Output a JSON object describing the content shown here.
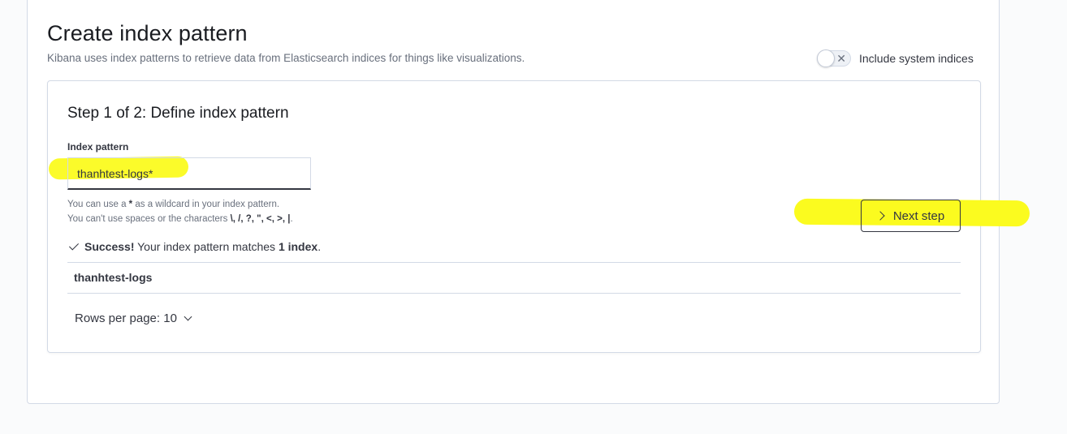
{
  "page": {
    "title": "Create index pattern",
    "description": "Kibana uses index patterns to retrieve data from Elasticsearch indices for things like visualizations."
  },
  "system_toggle": {
    "label": "Include system indices",
    "checked": false,
    "icon": "x-icon"
  },
  "step": {
    "title": "Step 1 of 2: Define index pattern",
    "field_label": "Index pattern",
    "input_value": "thanhtest-logs*",
    "help_line1_prefix": "You can use a ",
    "help_line1_star": "*",
    "help_line1_suffix": " as a wildcard in your index pattern.",
    "help_line2_prefix": "You can't use spaces or the characters ",
    "help_line2_chars": "\\, /, ?, \", <, >, |",
    "help_line2_suffix": ".",
    "next_button_label": "Next step",
    "success_strong": "Success!",
    "success_text": " Your index pattern matches ",
    "success_count": "1 index",
    "success_end": ".",
    "matches": [
      "thanhtest-logs"
    ],
    "rows_per_page": "Rows per page: 10"
  },
  "colors": {
    "highlight": "#fbfb1f",
    "text": "#343741",
    "subdued": "#69707d",
    "border": "#d3dae6"
  }
}
